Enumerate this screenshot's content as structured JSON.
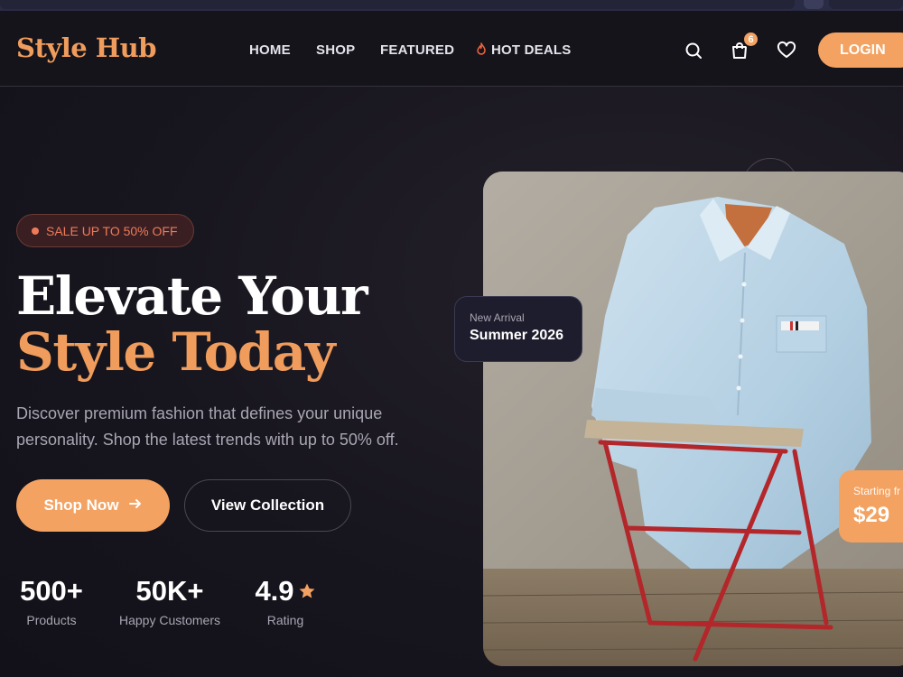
{
  "brand": {
    "name": "Style Hub"
  },
  "nav": {
    "items": [
      "HOME",
      "SHOP",
      "FEATURED",
      "HOT DEALS"
    ]
  },
  "header": {
    "cart_count": "6",
    "login_label": "LOGIN",
    "icons": [
      "search-icon",
      "cart-icon",
      "heart-icon",
      "flame-icon"
    ]
  },
  "hero": {
    "badge": "SALE UP TO 50% OFF",
    "title_line1": "Elevate Your",
    "title_line2": "Style Today",
    "description": "Discover premium fashion that defines your unique personality. Shop the latest trends with up to 50% off.",
    "primary_button": "Shop Now",
    "secondary_button": "View Collection",
    "stats": [
      {
        "value": "500+",
        "label": "Products"
      },
      {
        "value": "50K+",
        "label": "Happy Customers"
      },
      {
        "value": "4.9",
        "label": "Rating"
      }
    ]
  },
  "showcase": {
    "new_arrival_label": "New Arrival",
    "new_arrival_title": "Summer 2026",
    "price_label": "Starting fr",
    "price_value": "$29"
  },
  "colors": {
    "accent": "#f3a261",
    "brand_text": "#f09c5c",
    "sale": "#ee7a5a",
    "background": "#15131c"
  }
}
